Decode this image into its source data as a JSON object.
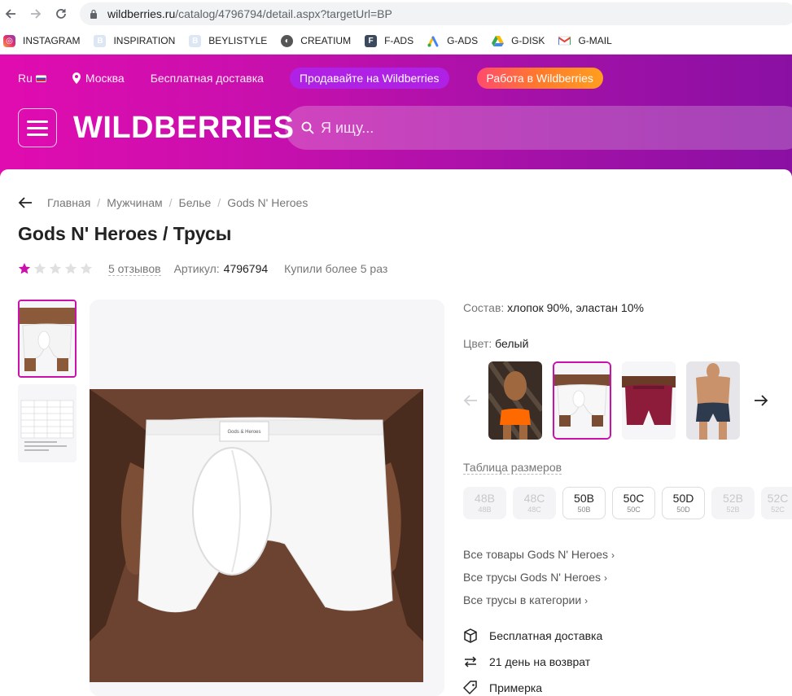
{
  "browser": {
    "url_domain": "wildberries.ru",
    "url_path": "/catalog/4796794/detail.aspx?targetUrl=BP",
    "bookmarks": [
      {
        "label": "INSTAGRAM",
        "icon": "instagram-icon"
      },
      {
        "label": "INSPIRATION",
        "icon": "blank-page-icon"
      },
      {
        "label": "BEYLISTYLE",
        "icon": "blank-page-icon"
      },
      {
        "label": "CREATIUM",
        "icon": "globe-icon"
      },
      {
        "label": "F-ADS",
        "icon": "f-ads-icon"
      },
      {
        "label": "G-ADS",
        "icon": "google-ads-icon"
      },
      {
        "label": "G-DISK",
        "icon": "google-drive-icon"
      },
      {
        "label": "G-MAIL",
        "icon": "gmail-icon"
      }
    ]
  },
  "header": {
    "lang": "Ru",
    "city": "Москва",
    "free_delivery": "Бесплатная доставка",
    "sell_button": "Продавайте на Wildberries",
    "work_button": "Работа в Wildberries",
    "logo": "WILDBERRIES",
    "search_placeholder": "Я ищу..."
  },
  "breadcrumbs": [
    "Главная",
    "Мужчинам",
    "Белье",
    "Gods N' Heroes"
  ],
  "product": {
    "title": "Gods N' Heroes / Трусы",
    "rating": 1,
    "rating_max": 5,
    "reviews": "5 отзывов",
    "article_label": "Артикул:",
    "article": "4796794",
    "bought": "Купили более 5 раз",
    "composition_label": "Состав:",
    "composition": "хлопок 90%, эластан 10%",
    "color_label": "Цвет:",
    "color": "белый",
    "size_table_link": "Таблица размеров",
    "sizes": [
      {
        "ru": "48B",
        "eu": "48B",
        "available": false
      },
      {
        "ru": "48C",
        "eu": "48C",
        "available": false
      },
      {
        "ru": "50B",
        "eu": "50B",
        "available": true
      },
      {
        "ru": "50C",
        "eu": "50C",
        "available": true
      },
      {
        "ru": "50D",
        "eu": "50D",
        "available": true
      },
      {
        "ru": "52B",
        "eu": "52B",
        "available": false
      },
      {
        "ru": "52C",
        "eu": "52C",
        "available": false
      }
    ],
    "brand_links": [
      "Все товары Gods N' Heroes",
      "Все трусы Gods N' Heroes",
      "Все трусы в категории"
    ],
    "features": [
      {
        "label": "Бесплатная доставка",
        "icon": "box-icon"
      },
      {
        "label": "21 день на возврат",
        "icon": "return-arrows-icon"
      },
      {
        "label": "Примерка",
        "icon": "tag-icon"
      }
    ],
    "label_tag_text": "Gods & Heroes"
  },
  "colors": {
    "brand_pink": "#cb11ab",
    "header_start": "#e10cb0",
    "header_end": "#8a10a3",
    "star_active": "#cb11ab",
    "star_inactive": "#e0e0e0"
  }
}
